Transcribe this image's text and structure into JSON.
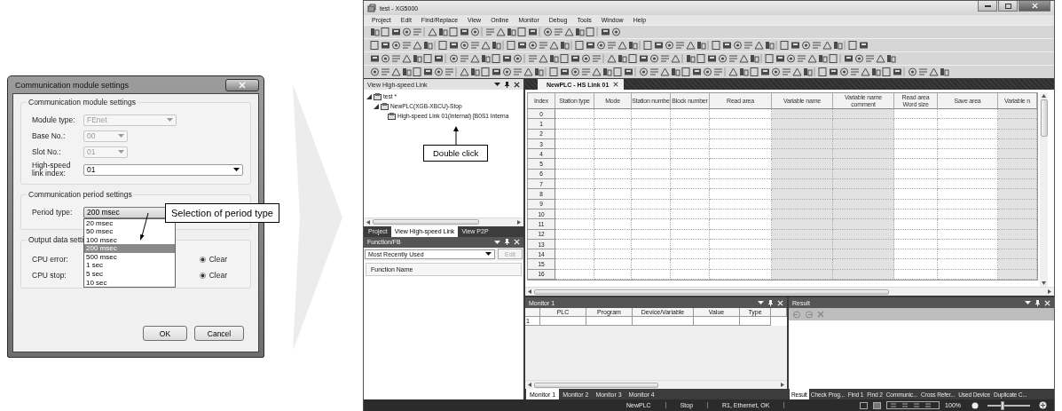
{
  "dialog": {
    "title": "Communication module settings",
    "module_group": {
      "title": "Communication module settings",
      "fields": [
        {
          "label": "Module type:",
          "value": "FEnet",
          "disabled": true
        },
        {
          "label": "Base No.:",
          "value": "00",
          "disabled": true
        },
        {
          "label": "Slot No.:",
          "value": "01",
          "disabled": true
        },
        {
          "label": "High-speed link index:",
          "value": "01",
          "disabled": false
        }
      ]
    },
    "period_group": {
      "title": "Communication period settings",
      "label": "Period type:",
      "value": "200 msec",
      "expanded": true,
      "options": [
        {
          "label": "20 msec",
          "selected": false
        },
        {
          "label": "50 msec",
          "selected": false
        },
        {
          "label": "100 msec",
          "selected": false
        },
        {
          "label": "200 msec",
          "selected": true
        },
        {
          "label": "500 msec",
          "selected": false
        },
        {
          "label": "1 sec",
          "selected": false
        },
        {
          "label": "5 sec",
          "selected": false
        },
        {
          "label": "10 sec",
          "selected": false
        }
      ]
    },
    "callout": "Selection of period type",
    "output_group": {
      "title": "Output data setti",
      "rows": [
        {
          "label": "CPU error:",
          "option": "Clear",
          "checked": true
        },
        {
          "label": "CPU stop:",
          "option": "Clear",
          "checked": true
        }
      ]
    },
    "buttons": [
      "OK",
      "Cancel"
    ]
  },
  "window": {
    "title": "test - XG5000",
    "menu": [
      "Project",
      "Edit",
      "Find/Replace",
      "View",
      "Online",
      "Monitor",
      "Debug",
      "Tools",
      "Window",
      "Help"
    ],
    "link_panel": {
      "title": "View High-speed Link",
      "tree": [
        {
          "label": "test *",
          "expanded": true,
          "children": [
            {
              "label": "NewPLC(XGB-XBCU)-Stop",
              "expanded": true,
              "children": [
                {
                  "label": "High-speed Link 01(Internal) [B0S1 Interna"
                }
              ]
            }
          ]
        }
      ],
      "callout": "Double click"
    },
    "left_tabs": [
      {
        "label": "Project",
        "selected": false
      },
      {
        "label": "View High-speed Link",
        "selected": true
      },
      {
        "label": "View P2P",
        "selected": false
      }
    ],
    "function_panel": {
      "title": "Function/FB",
      "filter": "Most Recently Used",
      "edit_button": {
        "label": "Edit",
        "disabled": true
      },
      "column": "Function Name"
    },
    "document": {
      "tab": "NewPLC - HS Link 01",
      "columns": [
        {
          "label": "Index"
        },
        {
          "label": "Station type",
          "disabled": false
        },
        {
          "label": "Mode",
          "disabled": false
        },
        {
          "label": "Station numbe",
          "disabled": false
        },
        {
          "label": "Block number",
          "disabled": false
        },
        {
          "label": "Read area",
          "disabled": false
        },
        {
          "label": "Variable name",
          "disabled": true
        },
        {
          "label": "Variable name comment",
          "disabled": true
        },
        {
          "label": "Read area Word size",
          "disabled": false
        },
        {
          "label": "Save area",
          "disabled": false
        },
        {
          "label": "Variable n",
          "disabled": true
        }
      ],
      "rows": [
        "0",
        "1",
        "2",
        "3",
        "4",
        "5",
        "6",
        "7",
        "8",
        "9",
        "10",
        "11",
        "12",
        "13",
        "14",
        "15",
        "16"
      ]
    },
    "monitor": {
      "title": "Monitor 1",
      "columns": [
        "PLC",
        "Program",
        "Device/Variable",
        "Value",
        "Type"
      ],
      "rows": [
        "1"
      ],
      "tabs": [
        {
          "label": "Monitor 1",
          "selected": true
        },
        {
          "label": "Monitor 2",
          "selected": false
        },
        {
          "label": "Monitor 3",
          "selected": false
        },
        {
          "label": "Monitor 4",
          "selected": false
        }
      ]
    },
    "result": {
      "title": "Result",
      "tabs": [
        {
          "label": "Result",
          "selected": true
        },
        {
          "label": "Check Prog...",
          "selected": false
        },
        {
          "label": "Find 1",
          "selected": false
        },
        {
          "label": "Find 2",
          "selected": false
        },
        {
          "label": "Communic...",
          "selected": false
        },
        {
          "label": "Cross Refer...",
          "selected": false
        },
        {
          "label": "Used Device",
          "selected": false
        },
        {
          "label": "Duplicate C...",
          "selected": false
        }
      ]
    },
    "status_bar": {
      "items": [
        "NewPLC",
        "Stop",
        "R1, Ethernet, OK"
      ],
      "zoom": "100%",
      "zoom_slider": {
        "level": 0.35
      }
    }
  }
}
